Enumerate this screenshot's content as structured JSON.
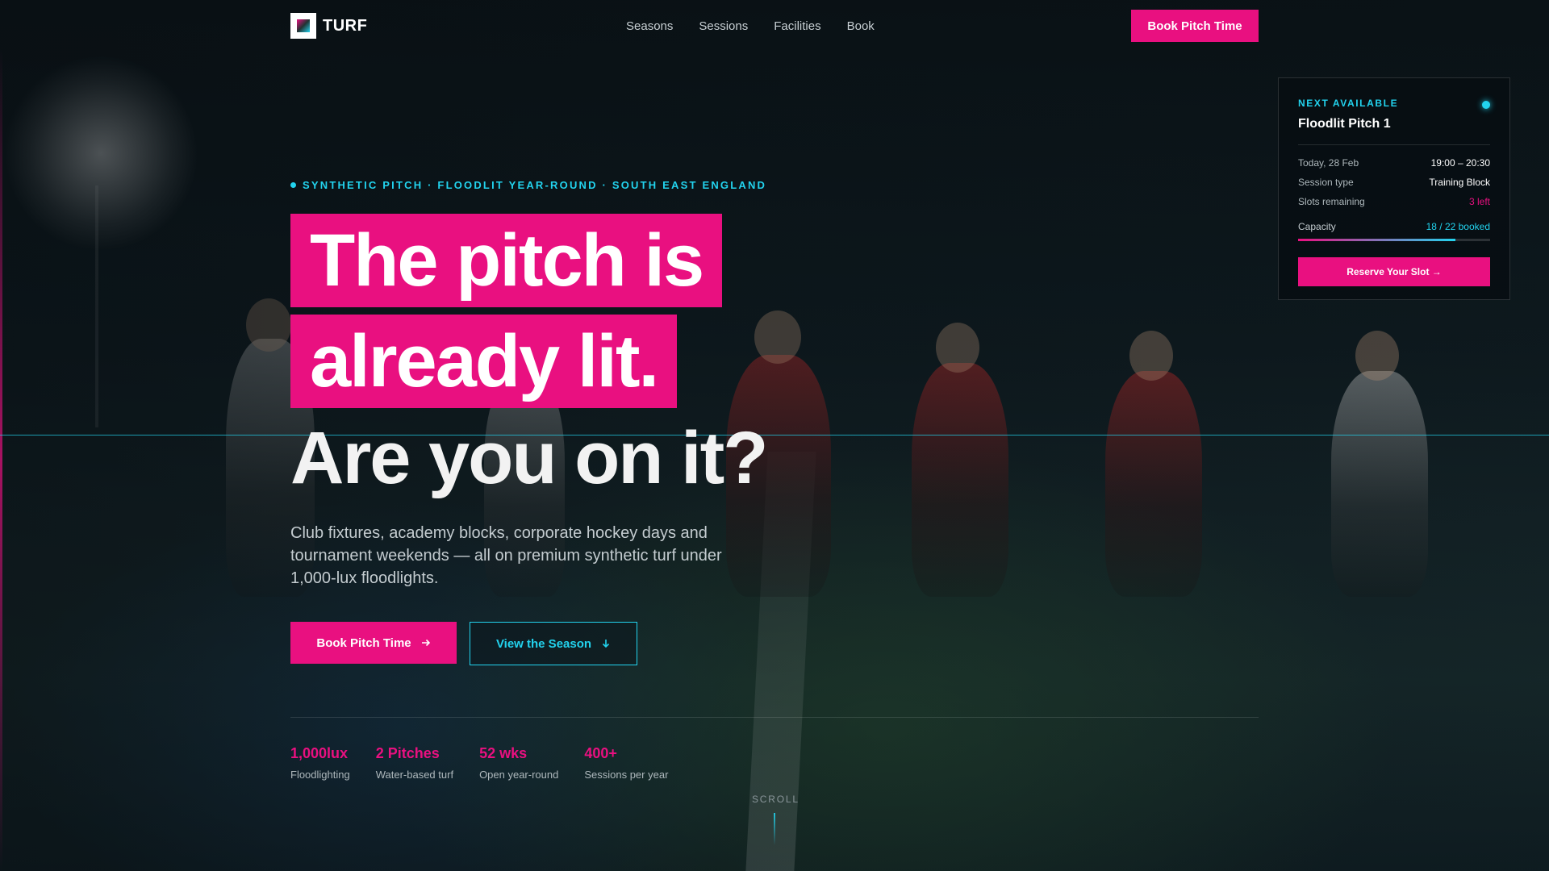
{
  "brand": {
    "name": "TURF"
  },
  "nav": {
    "links": [
      "Seasons",
      "Sessions",
      "Facilities",
      "Book"
    ],
    "cta": "Book Pitch Time"
  },
  "hero": {
    "eyebrow": "SYNTHETIC PITCH · FLOODLIT YEAR-ROUND · SOUTH EAST ENGLAND",
    "headline_line1": "The pitch is",
    "headline_line2": "already lit.",
    "headline_line3": "Are you on it?",
    "description": "Club fixtures, academy blocks, corporate hockey days and tournament weekends — all on premium synthetic turf under 1,000-lux floodlights.",
    "primary_cta": "Book Pitch Time",
    "secondary_cta": "View the Season"
  },
  "stats": [
    {
      "value": "1,000lux",
      "label": "Floodlighting"
    },
    {
      "value": "2 Pitches",
      "label": "Water-based turf"
    },
    {
      "value": "52 wks",
      "label": "Open year-round"
    },
    {
      "value": "400+",
      "label": "Sessions per year"
    }
  ],
  "scroll_label": "SCROLL",
  "availability_card": {
    "eyebrow": "NEXT AVAILABLE",
    "title": "Floodlit Pitch 1",
    "rows": [
      {
        "key": "Today, 28 Feb",
        "value": "19:00 – 20:30"
      },
      {
        "key": "Session type",
        "value": "Training Block"
      },
      {
        "key": "Slots remaining",
        "value": "3 left"
      }
    ],
    "capacity_label": "Capacity",
    "capacity_value": "18 / 22 booked",
    "capacity_fraction": 0.818,
    "cta": "Reserve Your Slot →"
  },
  "colors": {
    "accent_pink": "#e91080",
    "accent_cyan": "#22d3ee",
    "background": "#0b1418"
  },
  "icons": {
    "primary_cta_icon": "arrow-right-icon",
    "secondary_cta_icon": "arrow-down-icon",
    "status": "status-dot-icon"
  }
}
